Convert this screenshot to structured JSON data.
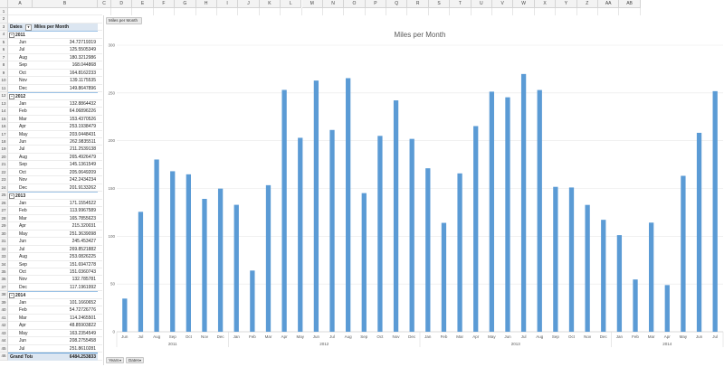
{
  "columns": [
    "A",
    "B",
    "C",
    "D",
    "E",
    "F",
    "G",
    "H",
    "I",
    "J",
    "K",
    "L",
    "M",
    "N",
    "O",
    "P",
    "Q",
    "R",
    "S",
    "T",
    "U",
    "V",
    "W",
    "X",
    "Y",
    "Z",
    "AA",
    "AB"
  ],
  "pivot": {
    "header_dates": "Dates",
    "header_miles": "Miles per Month",
    "filter_icon": "dropdown-filter-icon",
    "collapse_icon": "collapse-minus-icon",
    "groups": [
      {
        "year": "2011",
        "rows": [
          [
            "Jun",
            "34.72719319"
          ],
          [
            "Jul",
            "125.5505349"
          ],
          [
            "Aug",
            "180.3212986"
          ],
          [
            "Sep",
            "168.044868"
          ],
          [
            "Oct",
            "164.8162233"
          ],
          [
            "Nov",
            "139.1175535"
          ],
          [
            "Dec",
            "149.8647896"
          ]
        ]
      },
      {
        "year": "2012",
        "rows": [
          [
            "Jan",
            "132.8864432"
          ],
          [
            "Feb",
            "64.06896226"
          ],
          [
            "Mar",
            "153.4370526"
          ],
          [
            "Apr",
            "253.1938479"
          ],
          [
            "May",
            "203.0448431"
          ],
          [
            "Jun",
            "262.9835511"
          ],
          [
            "Jul",
            "211.2539138"
          ],
          [
            "Aug",
            "265.4926479"
          ],
          [
            "Sep",
            "145.1361549"
          ],
          [
            "Oct",
            "205.0649209"
          ],
          [
            "Nov",
            "242.2434234"
          ],
          [
            "Dec",
            "201.9133262"
          ]
        ]
      },
      {
        "year": "2013",
        "rows": [
          [
            "Jan",
            "171.1554522"
          ],
          [
            "Feb",
            "113.9967589"
          ],
          [
            "Mar",
            "165.7855623"
          ],
          [
            "Apr",
            "215.320031"
          ],
          [
            "May",
            "251.3639098"
          ],
          [
            "Jun",
            "245.453427"
          ],
          [
            "Jul",
            "269.8521882"
          ],
          [
            "Aug",
            "253.0826225"
          ],
          [
            "Sep",
            "151.6947278"
          ],
          [
            "Oct",
            "151.0360743"
          ],
          [
            "Nov",
            "132.785781"
          ],
          [
            "Dec",
            "117.1961992"
          ]
        ]
      },
      {
        "year": "2014",
        "rows": [
          [
            "Jan",
            "101.1660652"
          ],
          [
            "Feb",
            "54.72726776"
          ],
          [
            "Mar",
            "114.2465501"
          ],
          [
            "Apr",
            "48.85903822"
          ],
          [
            "May",
            "163.2354549"
          ],
          [
            "Jun",
            "208.2755458"
          ],
          [
            "Jul",
            "251.8610281"
          ]
        ]
      }
    ],
    "grand_total_label": "Grand Total",
    "grand_total_value": "6484.253833"
  },
  "chart_field_button": "Miles per Month",
  "axis_field_buttons": [
    {
      "label": "Years",
      "icon": "dropdown-filter-icon"
    },
    {
      "label": "Dates",
      "icon": "dropdown-filter-icon"
    }
  ],
  "chart_data": {
    "type": "bar",
    "title": "Miles per Month",
    "xlabel": "",
    "ylabel": "",
    "ylim": [
      0,
      300
    ],
    "yticks": [
      0,
      50,
      100,
      150,
      200,
      250,
      300
    ],
    "grid": true,
    "legend": "none",
    "bar_color": "#5b9bd5",
    "categories": [
      "Jun",
      "Jul",
      "Aug",
      "Sep",
      "Oct",
      "Nov",
      "Dec",
      "Jan",
      "Feb",
      "Mar",
      "Apr",
      "May",
      "Jun",
      "Jul",
      "Aug",
      "Sep",
      "Oct",
      "Nov",
      "Dec",
      "Jan",
      "Feb",
      "Mar",
      "Apr",
      "May",
      "Jun",
      "Jul",
      "Aug",
      "Sep",
      "Oct",
      "Nov",
      "Dec",
      "Jan",
      "Feb",
      "Mar",
      "Apr",
      "May",
      "Jun",
      "Jul"
    ],
    "year_groups": [
      {
        "label": "2011",
        "count": 7
      },
      {
        "label": "2012",
        "count": 12
      },
      {
        "label": "2013",
        "count": 12
      },
      {
        "label": "2014",
        "count": 7
      }
    ],
    "series": [
      {
        "values": [
          34.72719319,
          125.5505349,
          180.3212986,
          168.044868,
          164.8162233,
          139.1175535,
          149.8647896,
          132.8864432,
          64.06896226,
          153.4370526,
          253.1938479,
          203.0448431,
          262.9835511,
          211.2539138,
          265.4926479,
          145.1361549,
          205.0649209,
          242.2434234,
          201.9133262,
          171.1554522,
          113.9967589,
          165.7855623,
          215.320031,
          251.3639098,
          245.453427,
          269.8521882,
          253.0826225,
          151.6947278,
          151.0360743,
          132.785781,
          117.1961992,
          101.1660652,
          54.72726776,
          114.2465501,
          48.85903822,
          163.2354549,
          208.2755458,
          251.8610281
        ]
      }
    ]
  }
}
